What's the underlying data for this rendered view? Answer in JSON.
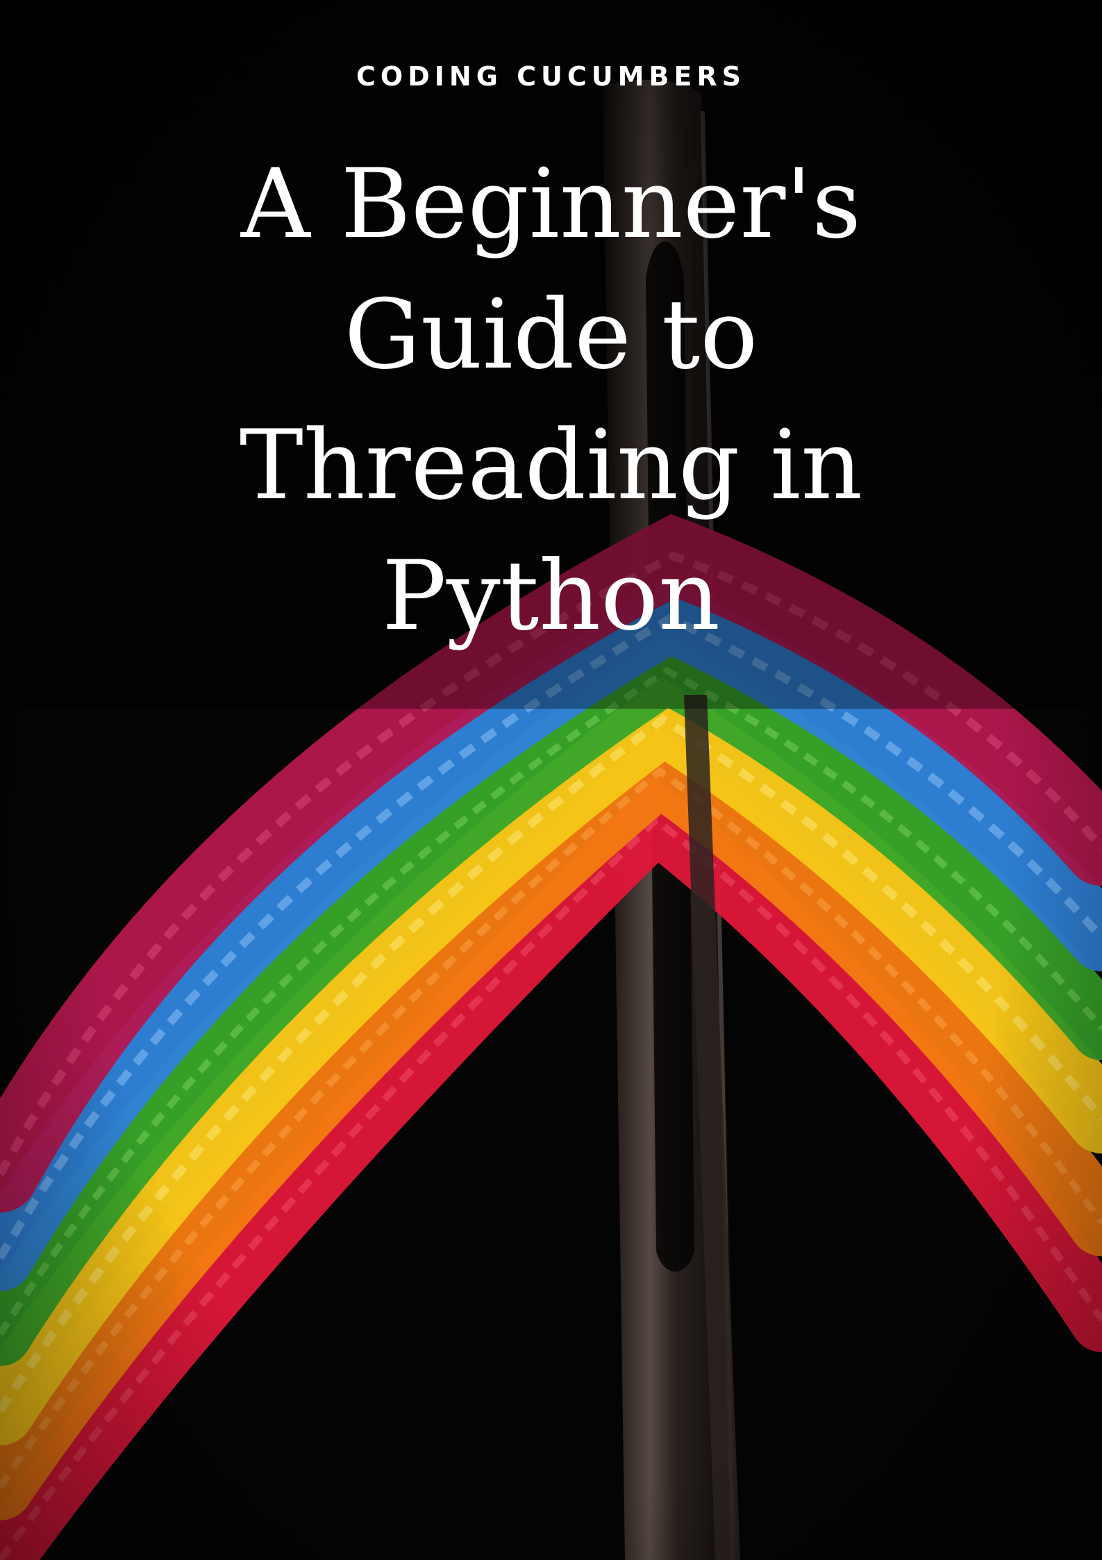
{
  "cover": {
    "publisher": "CODING CUCUMBERS",
    "title_lines": [
      "A Beginner's",
      "Guide to",
      "Threading in",
      "Python"
    ]
  },
  "image": {
    "subject": "needle-eye-with-rainbow-threads",
    "thread_colors": [
      "#b4174f",
      "#2f82d8",
      "#38a62a",
      "#f6c617",
      "#f37a12",
      "#e2173a"
    ],
    "needle_color": "#3c3430",
    "background_color": "#050404"
  }
}
